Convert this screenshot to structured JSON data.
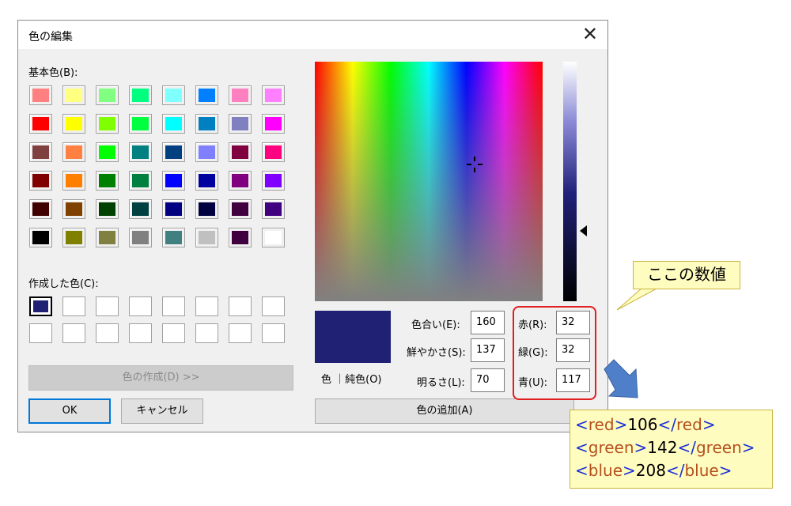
{
  "dialog": {
    "title": "色の編集",
    "close_glyph": "✕",
    "basic_colors_label": "基本色(B):",
    "custom_colors_label": "作成した色(C):",
    "basic_colors": [
      [
        "#ff8080",
        "#ffff80",
        "#80ff80",
        "#00ff80",
        "#80ffff",
        "#0080ff",
        "#ff80c0",
        "#ff80ff"
      ],
      [
        "#ff0000",
        "#ffff00",
        "#80ff00",
        "#00ff40",
        "#00ffff",
        "#0080c0",
        "#8080c0",
        "#ff00ff"
      ],
      [
        "#804040",
        "#ff8040",
        "#00ff00",
        "#008080",
        "#004080",
        "#8080ff",
        "#800040",
        "#ff0080"
      ],
      [
        "#800000",
        "#ff8000",
        "#008000",
        "#008040",
        "#0000ff",
        "#0000a0",
        "#800080",
        "#8000ff"
      ],
      [
        "#400000",
        "#804000",
        "#004000",
        "#004040",
        "#000080",
        "#000040",
        "#400040",
        "#400080"
      ],
      [
        "#000000",
        "#808000",
        "#808040",
        "#808080",
        "#408080",
        "#c0c0c0",
        "#400040",
        "#ffffff"
      ]
    ],
    "custom_colors": [
      [
        "#202075",
        "#ffffff",
        "#ffffff",
        "#ffffff",
        "#ffffff",
        "#ffffff",
        "#ffffff",
        "#ffffff"
      ],
      [
        "#ffffff",
        "#ffffff",
        "#ffffff",
        "#ffffff",
        "#ffffff",
        "#ffffff",
        "#ffffff",
        "#ffffff"
      ]
    ],
    "define_custom_button": "色の作成(D) >>",
    "ok_button": "OK",
    "cancel_button": "キャンセル",
    "add_color_button": "色の追加(A)",
    "preview_label": "色 ｜純色(O)",
    "preview_color": "#202075",
    "fields": {
      "hue_label": "色合い(E):",
      "hue_value": "160",
      "sat_label": "鮮やかさ(S):",
      "sat_value": "137",
      "lum_label": "明るさ(L):",
      "lum_value": "70",
      "red_label": "赤(R):",
      "red_value": "32",
      "green_label": "緑(G):",
      "green_value": "32",
      "blue_label": "青(U):",
      "blue_value": "117"
    }
  },
  "annotation": {
    "callout_text": "ここの数値",
    "xml_lines": [
      {
        "tag": "red",
        "value": "106"
      },
      {
        "tag": "green",
        "value": "142"
      },
      {
        "tag": "blue",
        "value": "208"
      }
    ],
    "highlight_color": "#e02020",
    "arrow_color": "#4f7fc8"
  }
}
